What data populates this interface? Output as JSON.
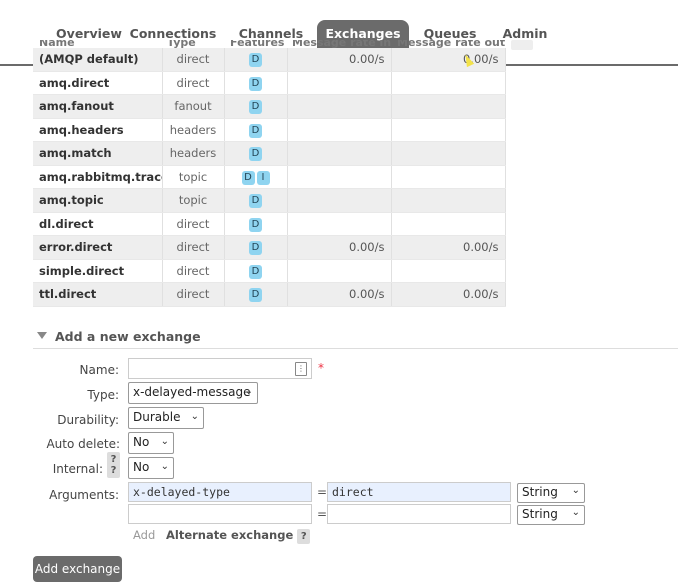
{
  "nav": {
    "tabs": [
      {
        "label": "Overview"
      },
      {
        "label": "Connections"
      },
      {
        "label": "Channels"
      },
      {
        "label": "Exchanges"
      },
      {
        "label": "Queues"
      },
      {
        "label": "Admin"
      }
    ],
    "active": "Exchanges"
  },
  "table": {
    "headers": [
      "Name",
      "Type",
      "Features",
      "Message rate in",
      "Message rate out"
    ],
    "rows": [
      {
        "name": "(AMQP default)",
        "type": "direct",
        "features": [
          "D"
        ],
        "rate_in": "0.00/s",
        "rate_out": "0.00/s"
      },
      {
        "name": "amq.direct",
        "type": "direct",
        "features": [
          "D"
        ],
        "rate_in": "",
        "rate_out": ""
      },
      {
        "name": "amq.fanout",
        "type": "fanout",
        "features": [
          "D"
        ],
        "rate_in": "",
        "rate_out": ""
      },
      {
        "name": "amq.headers",
        "type": "headers",
        "features": [
          "D"
        ],
        "rate_in": "",
        "rate_out": ""
      },
      {
        "name": "amq.match",
        "type": "headers",
        "features": [
          "D"
        ],
        "rate_in": "",
        "rate_out": ""
      },
      {
        "name": "amq.rabbitmq.trace",
        "type": "topic",
        "features": [
          "D",
          "I"
        ],
        "rate_in": "",
        "rate_out": ""
      },
      {
        "name": "amq.topic",
        "type": "topic",
        "features": [
          "D"
        ],
        "rate_in": "",
        "rate_out": ""
      },
      {
        "name": "dl.direct",
        "type": "direct",
        "features": [
          "D"
        ],
        "rate_in": "",
        "rate_out": ""
      },
      {
        "name": "error.direct",
        "type": "direct",
        "features": [
          "D"
        ],
        "rate_in": "0.00/s",
        "rate_out": "0.00/s"
      },
      {
        "name": "simple.direct",
        "type": "direct",
        "features": [
          "D"
        ],
        "rate_in": "",
        "rate_out": ""
      },
      {
        "name": "ttl.direct",
        "type": "direct",
        "features": [
          "D"
        ],
        "rate_in": "0.00/s",
        "rate_out": "0.00/s"
      }
    ]
  },
  "add_exchange": {
    "section_title": "Add a new exchange",
    "name_label": "Name:",
    "name_value": "",
    "required_mark": "*",
    "type_label": "Type:",
    "type_value": "x-delayed-message",
    "durability_label": "Durability:",
    "durability_value": "Durable",
    "auto_delete_label": "Auto delete:",
    "auto_delete_value": "No",
    "internal_label": "Internal:",
    "internal_value": "No",
    "arguments_label": "Arguments:",
    "arguments": [
      {
        "key": "x-delayed-type",
        "value": "direct",
        "type": "String"
      },
      {
        "key": "",
        "value": "",
        "type": "String"
      }
    ],
    "equals": "=",
    "add_link": "Add",
    "alternate_exchange": "Alternate exchange",
    "help_mark": "?",
    "submit_label": "Add exchange"
  },
  "colors": {
    "nav_active_bg": "#6b6b6b",
    "badge": "#8fd4f0",
    "arg_filled": "#e8f0fe"
  }
}
